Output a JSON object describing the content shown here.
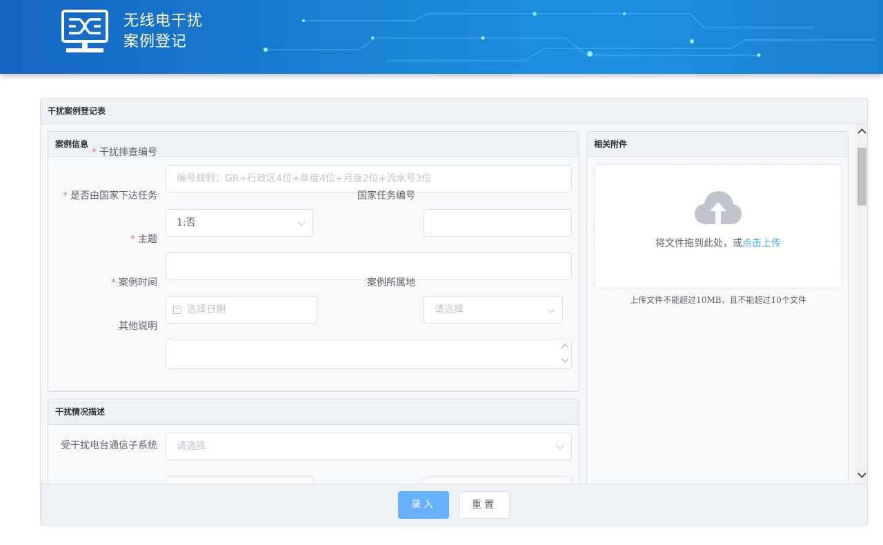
{
  "header": {
    "title_line1": "无线电干扰",
    "title_line2": "案例登记"
  },
  "main": {
    "panel_title": "干扰案例登记表"
  },
  "case_info": {
    "title": "案例信息",
    "fields": {
      "code_label": "干扰排查编号",
      "code_placeholder": "编号规则：GR+行政区4位+年度4位+月度2位+流水号3位",
      "national_task_label": "是否由国家下达任务",
      "national_task_value": "1:否",
      "national_task_no_label": "国家任务编号",
      "national_task_no_value": "",
      "subject_label": "主题",
      "subject_value": "",
      "case_time_label": "案例时间",
      "case_time_placeholder": "选择日期",
      "case_location_label": "案例所属地",
      "case_location_placeholder": "请选择",
      "other_label": "其他说明",
      "other_value": ""
    }
  },
  "interference": {
    "title": "干扰情况描述",
    "fields": {
      "subsystem_label": "受干扰电台通信子系统",
      "subsystem_placeholder": "请选择"
    }
  },
  "attachments": {
    "title": "相关附件",
    "drop_text": "将文件拖到此处，或",
    "click_upload": "点击上传",
    "tip": "上传文件不能超过10MB，且不能超过10个文件"
  },
  "actions": {
    "submit": "录入",
    "reset": "重置"
  },
  "colors": {
    "primary": "#66b1ff",
    "required": "#f56c6c",
    "link": "#409eff",
    "header_blue": "#1a86d6"
  }
}
